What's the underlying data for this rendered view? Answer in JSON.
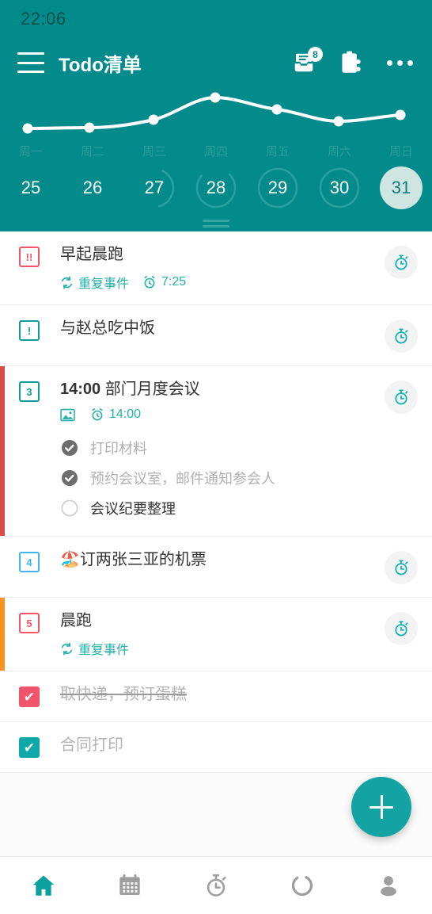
{
  "status_bar": {
    "time": "22:06"
  },
  "app_bar": {
    "menu_icon": "hamburger-menu-icon",
    "title": "Todo清单",
    "inbox_icon": "inbox-archive-icon",
    "inbox_badge": "8",
    "share_icon": "clipboard-share-icon",
    "overflow_icon": "overflow-menu-icon"
  },
  "chart_data": {
    "type": "line",
    "title": "",
    "categories": [
      "周一",
      "周二",
      "周三",
      "周四",
      "周五",
      "周六",
      "周日"
    ],
    "values": [
      2,
      2.1,
      2.8,
      5.2,
      4.1,
      3.0,
      3.6
    ],
    "series": [
      {
        "name": "每周任务量",
        "values": [
          2,
          2.1,
          2.8,
          5.2,
          4.1,
          3.0,
          3.6
        ]
      }
    ],
    "xlabel": "",
    "ylabel": "",
    "ylim": [
      0,
      6
    ],
    "grid": false,
    "legend": "none",
    "line_color": "#ffffff",
    "point_color": "#ffffff",
    "background": "#038b8b",
    "tick_label_color": "#2f9b9b"
  },
  "date_strip": {
    "days": [
      {
        "num": "25",
        "progress": 0,
        "selected": false
      },
      {
        "num": "26",
        "progress": 0,
        "selected": false
      },
      {
        "num": "27",
        "progress": 0.4,
        "selected": false
      },
      {
        "num": "28",
        "progress": 0.75,
        "selected": false
      },
      {
        "num": "29",
        "progress": 1,
        "selected": false
      },
      {
        "num": "30",
        "progress": 1,
        "selected": false
      },
      {
        "num": "31",
        "progress": 0,
        "selected": true
      }
    ],
    "drag_handle": "drag-handle"
  },
  "tasks": [
    {
      "id": "task-1",
      "accent": "",
      "box_label": "!!",
      "box_color": "#f2546b",
      "completed": false,
      "title": "早起晨跑",
      "title_bold": "",
      "meta": [
        {
          "icon": "repeat-icon",
          "text": "重复事件"
        },
        {
          "icon": "alarm-icon",
          "text": "7:25"
        }
      ],
      "subtasks": [],
      "timer_icon": "stopwatch-icon"
    },
    {
      "id": "task-2",
      "accent": "",
      "box_label": "!",
      "box_color": "#129b9b",
      "completed": false,
      "title": "与赵总吃中饭",
      "title_bold": "",
      "meta": [],
      "subtasks": [],
      "timer_icon": "stopwatch-icon"
    },
    {
      "id": "task-3",
      "accent": "#d94d45",
      "box_label": "3",
      "box_color": "#129b9b",
      "completed": false,
      "title": "部门月度会议",
      "title_bold": "14:00",
      "meta": [
        {
          "icon": "image-icon",
          "text": ""
        },
        {
          "icon": "alarm-icon",
          "text": "14:00"
        }
      ],
      "subtasks": [
        {
          "text": "打印材料",
          "done": true
        },
        {
          "text": "预约会议室，邮件通知参会人",
          "done": true
        },
        {
          "text": "会议纪要整理",
          "done": false
        }
      ],
      "timer_icon": "stopwatch-icon"
    },
    {
      "id": "task-4",
      "accent": "",
      "box_label": "4",
      "box_color": "#3fb6ef",
      "completed": false,
      "title": "🏖️订两张三亚的机票",
      "title_bold": "",
      "meta": [],
      "subtasks": [],
      "timer_icon": "stopwatch-icon"
    },
    {
      "id": "task-5",
      "accent": "#f79421",
      "box_label": "5",
      "box_color": "#f2546b",
      "completed": false,
      "title": "晨跑",
      "title_bold": "",
      "meta": [
        {
          "icon": "repeat-icon",
          "text": "重复事件"
        }
      ],
      "subtasks": [],
      "timer_icon": "stopwatch-icon"
    },
    {
      "id": "task-6",
      "accent": "",
      "box_label": "✔",
      "box_color": "#f2546b",
      "completed": true,
      "strike": true,
      "title": "取快递，预订蛋糕",
      "title_bold": "",
      "meta": [],
      "subtasks": [],
      "timer_icon": ""
    },
    {
      "id": "task-7",
      "accent": "",
      "box_label": "✔",
      "box_color": "#0fa8a8",
      "completed": true,
      "strike": false,
      "title": "合同打印",
      "title_bold": "",
      "meta": [],
      "subtasks": [],
      "timer_icon": ""
    }
  ],
  "fab": {
    "icon": "plus-icon",
    "label": "",
    "color": "#14a3a3"
  },
  "bottom_nav": {
    "items": [
      {
        "icon": "home-icon",
        "active": true
      },
      {
        "icon": "calendar-icon",
        "active": false
      },
      {
        "icon": "stopwatch-icon",
        "active": false
      },
      {
        "icon": "progress-ring-icon",
        "active": false
      },
      {
        "icon": "person-icon",
        "active": false
      }
    ],
    "active_color": "#0ba0a0",
    "inactive_color": "#9e9e9e"
  }
}
